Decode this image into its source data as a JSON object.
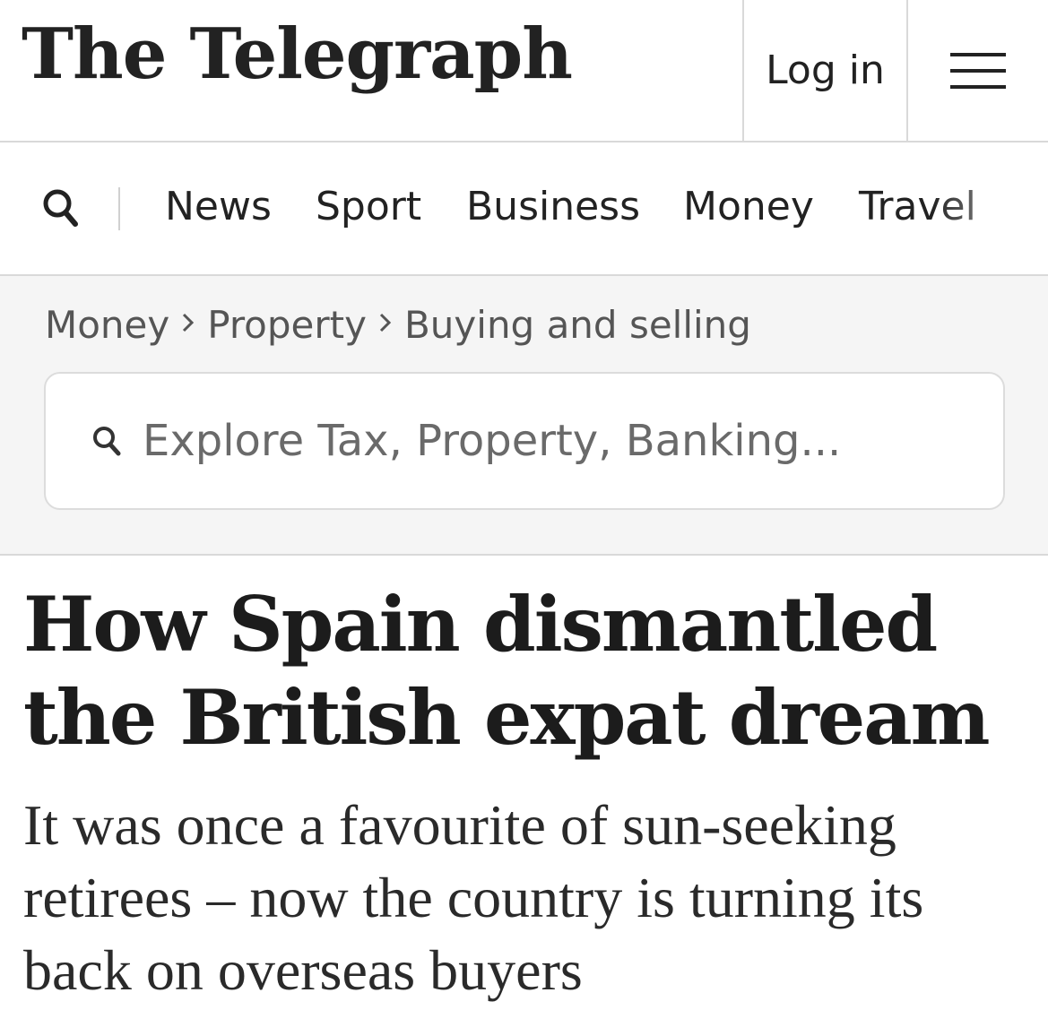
{
  "header": {
    "logo_text": "The Telegraph",
    "login_label": "Log in",
    "menu_icon": "hamburger-menu-icon"
  },
  "nav": {
    "search_icon": "search-icon",
    "items": [
      {
        "label": "News"
      },
      {
        "label": "Sport"
      },
      {
        "label": "Business"
      },
      {
        "label": "Money"
      },
      {
        "label": "Travel"
      }
    ]
  },
  "breadcrumb": {
    "items": [
      {
        "label": "Money"
      },
      {
        "label": "Property"
      },
      {
        "label": "Buying and selling"
      }
    ],
    "separator_icon": "chevron-right-icon"
  },
  "search": {
    "placeholder": "Explore Tax, Property, Banking..."
  },
  "article": {
    "headline": "How Spain dismantled the British expat dream",
    "standfirst": "It was once a favourite of sun-seeking retirees – now the country is turning its back on overseas buyers"
  }
}
